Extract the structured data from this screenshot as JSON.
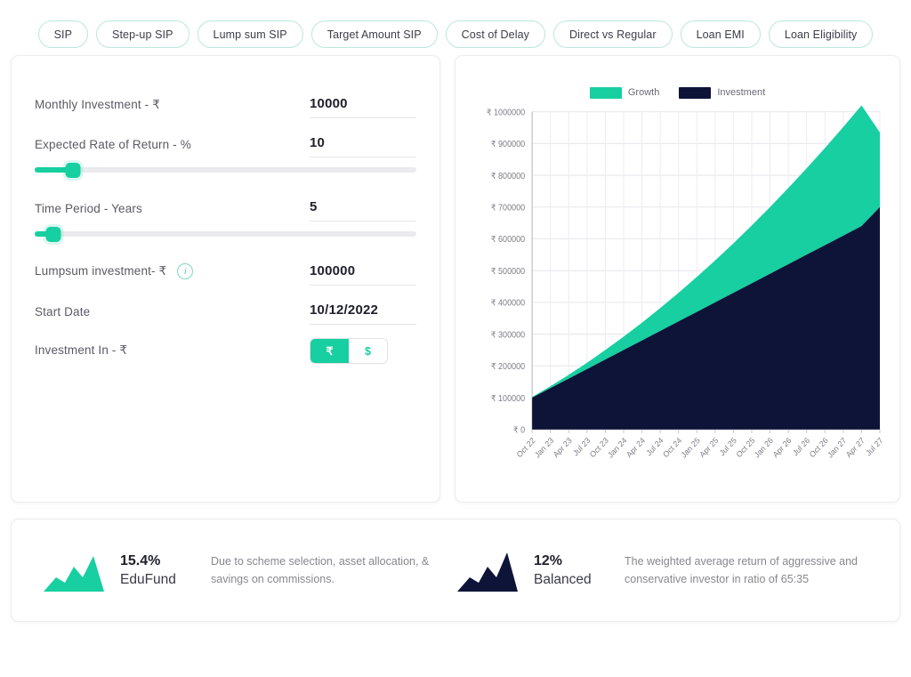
{
  "nav": {
    "tabs": [
      {
        "label": "SIP"
      },
      {
        "label": "Step-up SIP"
      },
      {
        "label": "Lump sum SIP"
      },
      {
        "label": "Target Amount SIP"
      },
      {
        "label": "Cost of Delay"
      },
      {
        "label": "Direct vs Regular"
      },
      {
        "label": "Loan EMI"
      },
      {
        "label": "Loan Eligibility"
      }
    ]
  },
  "colors": {
    "growth": "#17cfa0",
    "investment": "#0d1437",
    "pill_border": "#b9e7dd",
    "track": "#ebebee"
  },
  "form": {
    "monthly_investment": {
      "label": "Monthly Investment - ₹",
      "value": "10000"
    },
    "expected_return": {
      "label": "Expected Rate of Return - %",
      "value": "10",
      "slider_percent": 10
    },
    "time_period": {
      "label": "Time Period - Years",
      "value": "5",
      "slider_percent": 5
    },
    "lumpsum": {
      "label": "Lumpsum investment- ₹",
      "value": "100000",
      "info_icon": "info-icon"
    },
    "start_date": {
      "label": "Start Date",
      "value": "10/12/2022"
    },
    "investment_in": {
      "label": "Investment In - ₹",
      "options": [
        "₹",
        "$"
      ],
      "selected": "₹"
    }
  },
  "chart_data": {
    "type": "area",
    "stacked": true,
    "title": "",
    "xlabel": "",
    "ylabel": "",
    "ylim": [
      0,
      1000000
    ],
    "ytick_labels": [
      "₹ 1000000",
      "₹ 900000",
      "₹ 800000",
      "₹ 700000",
      "₹ 600000",
      "₹ 500000",
      "₹ 400000",
      "₹ 300000",
      "₹ 200000",
      "₹ 100000",
      "₹ 0"
    ],
    "ytick_values": [
      1000000,
      900000,
      800000,
      700000,
      600000,
      500000,
      400000,
      300000,
      200000,
      100000,
      0
    ],
    "grid": true,
    "legend_position": "top-center",
    "categories": [
      "Oct 22",
      "Jan 23",
      "Apr 23",
      "Jul 23",
      "Oct 23",
      "Jan 24",
      "Apr 24",
      "Jul 24",
      "Oct 24",
      "Jan 25",
      "Apr 25",
      "Jul 25",
      "Oct 25",
      "Jan 26",
      "Apr 26",
      "Jul 26",
      "Oct 26",
      "Jan 27",
      "Apr 27",
      "Jul 27"
    ],
    "series": [
      {
        "name": "Investment",
        "color": "#0d1437",
        "values": [
          100000,
          130000,
          160000,
          190000,
          220000,
          250000,
          280000,
          310000,
          340000,
          370000,
          400000,
          430000,
          460000,
          490000,
          520000,
          550000,
          580000,
          610000,
          640000,
          700000
        ]
      },
      {
        "name": "Growth",
        "color": "#17cfa0",
        "values": [
          2000,
          6000,
          12000,
          20000,
          30000,
          42000,
          56000,
          72000,
          90000,
          110000,
          132000,
          156000,
          182000,
          210000,
          240000,
          272000,
          306000,
          342000,
          380000,
          235000
        ]
      }
    ],
    "totals": [
      102000,
      136000,
      172000,
      210000,
      250000,
      292000,
      336000,
      382000,
      430000,
      480000,
      532000,
      586000,
      642000,
      700000,
      760000,
      822000,
      886000,
      952000,
      1020000,
      935000
    ]
  },
  "footer": {
    "stats": [
      {
        "percent": "15.4%",
        "name": "EduFund",
        "description": "Due to scheme selection, asset allocation, & savings on commissions.",
        "color": "#17cfa0",
        "icon": "area-spark-icon"
      },
      {
        "percent": "12%",
        "name": "Balanced",
        "description": "The weighted average return of aggressive and conservative investor in ratio of 65:35",
        "color": "#0d1437",
        "icon": "area-spark-icon"
      }
    ]
  }
}
